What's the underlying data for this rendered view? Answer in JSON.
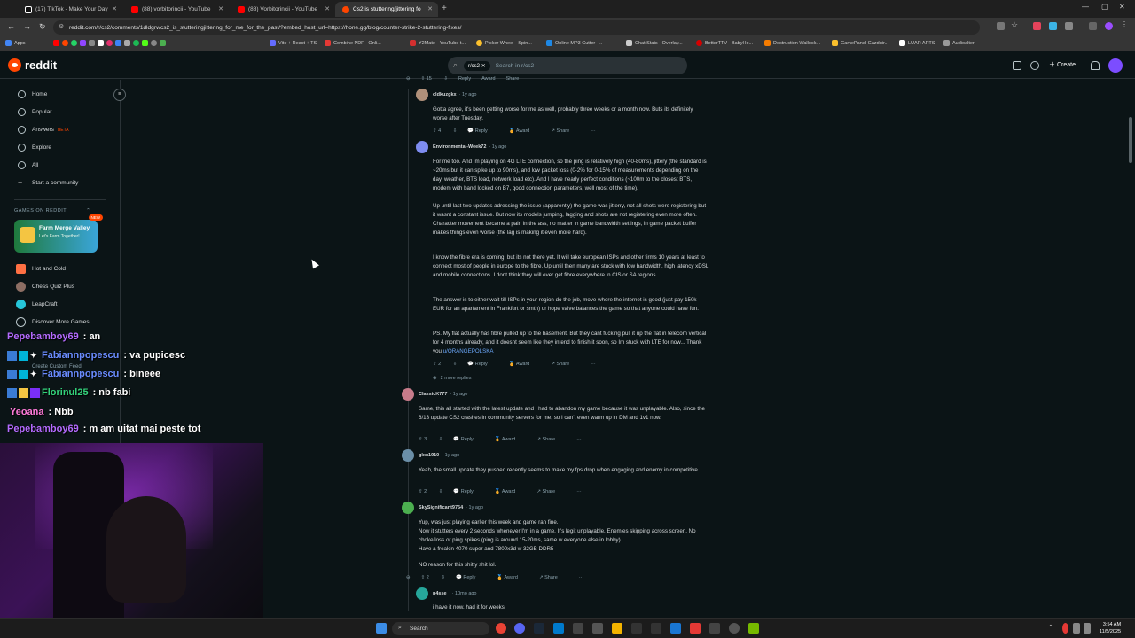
{
  "browser": {
    "tabs": [
      {
        "title": "(17) TikTok - Make Your Day",
        "color": "#ffffff"
      },
      {
        "title": "(88) vorbitorincii - YouTube",
        "color": "#ff0000"
      },
      {
        "title": "(88) Vorbitorincii - YouTube",
        "color": "#ff0000"
      },
      {
        "title": "Cs2 is stuttering/jittering fo",
        "color": "#ff4500"
      }
    ],
    "url": "reddit.com/r/cs2/comments/1dldgrv/cs2_is_stutteringjittering_for_me_for_the_past/?embed_host_url=https://hone.gg/blog/counter-strike-2-stuttering-fixes/",
    "bookmarks": [
      "Apps",
      "Vite + React + TS",
      "Combine PDF - Onli...",
      "Y2Mate - YouTube t...",
      "Picker Wheel - Spin...",
      "Online MP3 Cutter -...",
      "Chat Stats - Overlay...",
      "BetterTTV - BabyHo...",
      "Destruction Wallock...",
      "GamePanel Gazduir...",
      "LUAR ARTS",
      "Audioalter"
    ]
  },
  "reddit": {
    "logo": "reddit",
    "search_chip": "r/cs2",
    "search_placeholder": "Search in r/cs2",
    "create_label": "Create",
    "sidebar": {
      "items": [
        {
          "label": "Home",
          "icon": "home-icon"
        },
        {
          "label": "Popular",
          "icon": "popular-icon"
        },
        {
          "label": "Answers",
          "icon": "answers-icon",
          "badge": "BETA"
        },
        {
          "label": "Explore",
          "icon": "explore-icon"
        },
        {
          "label": "All",
          "icon": "all-icon"
        },
        {
          "label": "Start a community",
          "icon": "plus-icon"
        }
      ],
      "games_heading": "GAMES ON REDDIT",
      "farm_card": {
        "title": "Farm Merge Valley",
        "subtitle": "Let's Farm Together!",
        "badge": "NEW"
      },
      "games": [
        "Hot and Cold",
        "Chess Quiz Plus",
        "LeapCraft",
        "Discover More Games"
      ],
      "custom_feed": "Create Custom Feed"
    },
    "comments": [
      {
        "user": "cldkuzgkx",
        "time": "1y ago",
        "text": "Gotta agree, it's been getting worse for me as well, probably three weeks or a month now. Buts its definitely worse after Tuesday.",
        "votes": "4"
      },
      {
        "user": "Environmental-Week72",
        "time": "1y ago",
        "paragraphs": [
          "For me too. And Im playing on 4G LTE connection, so the ping is relatively high (40-80ms), jittery (the standard is ~20ms but it can spike up to 90ms), and low packet loss (0-2% for 0-15% of measurements depending on the day, weather, BTS load, network load etc). And I have nearly perfect conditions (~100m to the closest BTS, modem with band locked on B7, good connection parameters, well most of the time).",
          "Up until last two updates adressing the issue (apparently) the game was jitterry, not all shots were registering but it wasnt a constant issue. But now its models jumping, lagging and shots are not registering even more often. Character movement became a pain in the ass, no matter in game bandwidth settings, in game packet buffer makes things even worse (the lag is making it even more hard).",
          "I know the fibre era is coming, but its not there yet. It will take european ISPs and other firms 10 years at least to connect most of people in europe to the fibre. Up until then many are stuck with low bandwidth, high latency xDSL and mobile connections. I dont think they will ever get fibre everywhere in CIS or SA regions...",
          "The answer is to either wait till ISPs in your region do the job, move where the internet is good (just pay 150k EUR for an apartament in Frankfurt or smth) or hope valve balances the game so that anyone could have fun.",
          "PS. My flat actually has fibre pulled up to the basement. But they cant fucking pull it up the flat in telecom vertical for 4 months already, and it doesnt seem like they intend to finish it soon, so Im stuck with LTE for now... Thank you"
        ],
        "mention": "u/ORANGEPOLSKA",
        "votes": "2",
        "more_replies": "2 more replies"
      },
      {
        "user": "ClassicK777",
        "time": "1y ago",
        "text": "Same, this all started with the latest update and I had to abandon my game because it was unplayable. Also, since the 6/13 update CS2 crashes in community servers for me, so I can't even warm up in DM and 1v1 now.",
        "votes": "3"
      },
      {
        "user": "glxx1910",
        "time": "1y ago",
        "text": "Yeah, the small update they pushed recently seems to make my fps drop when engaging and enemy in competitive",
        "votes": "2"
      },
      {
        "user": "SkySignificant9754",
        "time": "1y ago",
        "lines": [
          "Yup, was just playing earlier this week and game ran fine.",
          "Now it stutters every 2 seconds whenever I'm in a game. It's legit unplayable. Enemies skipping across screen. No choke/loss or ping spikes (ping is around 15-20ms, same w everyone else in lobby).",
          "Have a freakin 4070 super and 7800x3d w 32GB DDR5"
        ],
        "extra": "NO reason for this shitty shit lol.",
        "votes": "2"
      },
      {
        "user": "n4sse_",
        "time": "10mo ago",
        "text": "i have it now. had it for weeks"
      }
    ],
    "actions": {
      "reply": "Reply",
      "award": "Award",
      "share": "Share",
      "more": "···"
    },
    "top_votes": "15"
  },
  "chat": [
    {
      "user": "Pepebamboy69",
      "msg": "an",
      "color": "#b56bff"
    },
    {
      "user": "Fabiannpopescu",
      "msg": "va pupicesc",
      "color": "#6a8cff"
    },
    {
      "user": "Fabiannpopescu",
      "msg": "bineee",
      "color": "#6a8cff"
    },
    {
      "user": "Florinul25",
      "msg": "nb fabi",
      "color": "#33d17a"
    },
    {
      "user": "Yeoana",
      "msg": "Nbb",
      "color": "#ff7ad9"
    },
    {
      "user": "Pepebamboy69",
      "msg": "m am uitat mai peste tot",
      "color": "#b56bff"
    }
  ],
  "taskbar": {
    "search": "Search",
    "time": "3:54 AM",
    "date": "11/5/2025"
  }
}
